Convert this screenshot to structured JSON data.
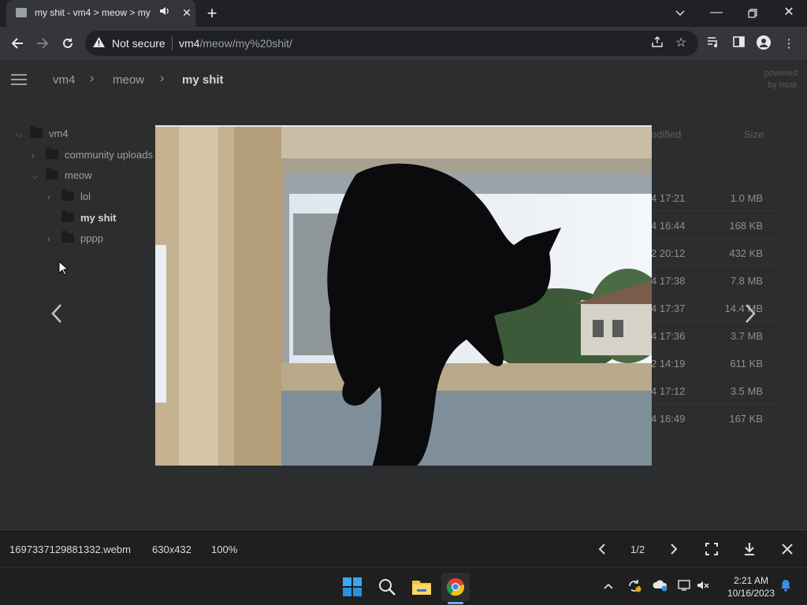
{
  "browser": {
    "tab_title": "my shit - vm4 > meow > my",
    "address": {
      "security_text": "Not secure",
      "host": "vm4",
      "path": "/meow/my%20shit/"
    }
  },
  "filemanager": {
    "breadcrumb": [
      "vm4",
      "meow",
      "my shit"
    ],
    "powered_by": [
      "powered",
      "by hsak"
    ],
    "tree": [
      {
        "label": "vm4",
        "expanded": true,
        "level": 0
      },
      {
        "label": "community uploads",
        "expanded": false,
        "level": 1
      },
      {
        "label": "meow",
        "expanded": true,
        "level": 1
      },
      {
        "label": "lol",
        "expanded": false,
        "level": 2
      },
      {
        "label": "my shit",
        "expanded": false,
        "level": 2,
        "current": true
      },
      {
        "label": "pppp",
        "expanded": false,
        "level": 2
      }
    ],
    "columns": {
      "modified": "odified",
      "size": "Size"
    },
    "rows": [
      {
        "date": "4 17:21",
        "size": "1.0 MB"
      },
      {
        "date": "4 16:44",
        "size": "168 KB"
      },
      {
        "date": "2 20:12",
        "size": "432 KB"
      },
      {
        "date": "4 17:38",
        "size": "7.8 MB"
      },
      {
        "date": "4 17:37",
        "size": "14.4 MB"
      },
      {
        "date": "4 17:36",
        "size": "3.7 MB"
      },
      {
        "date": "2 14:19",
        "size": "611 KB"
      },
      {
        "date": "4 17:12",
        "size": "3.5 MB"
      },
      {
        "date": "4 16:49",
        "size": "167 KB"
      }
    ]
  },
  "viewer": {
    "filename": "1697337129881332.webm",
    "dimensions": "630x432",
    "zoom": "100%",
    "counter": "1/2"
  },
  "taskbar": {
    "time": "2:21 AM",
    "date": "10/16/2023"
  }
}
